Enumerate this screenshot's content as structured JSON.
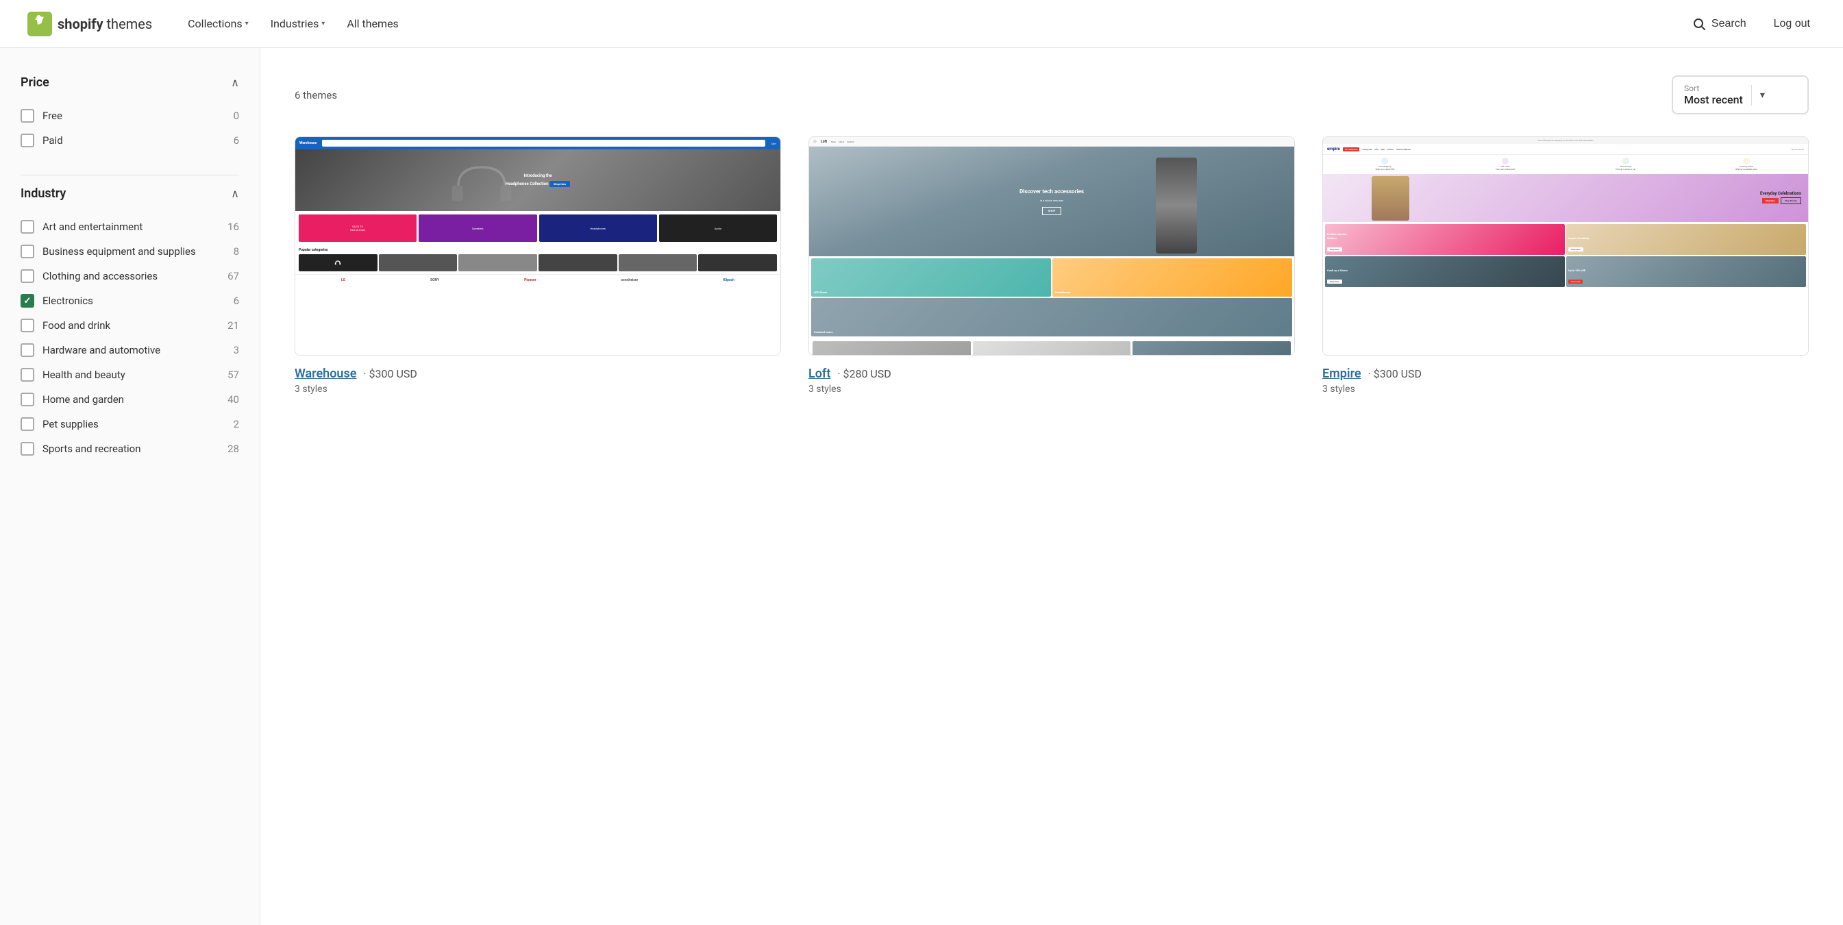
{
  "header": {
    "logo_text_brand": "shopify",
    "logo_text_suffix": " themes",
    "nav": [
      {
        "id": "collections",
        "label": "Collections",
        "has_dropdown": true
      },
      {
        "id": "industries",
        "label": "Industries",
        "has_dropdown": true
      },
      {
        "id": "all-themes",
        "label": "All themes",
        "has_dropdown": false
      }
    ],
    "search_label": "Search",
    "logout_label": "Log out"
  },
  "sidebar": {
    "price_section": {
      "title": "Price",
      "items": [
        {
          "id": "free",
          "label": "Free",
          "count": "0",
          "checked": false
        },
        {
          "id": "paid",
          "label": "Paid",
          "count": "6",
          "checked": false
        }
      ]
    },
    "industry_section": {
      "title": "Industry",
      "items": [
        {
          "id": "art",
          "label": "Art and entertainment",
          "count": "16",
          "checked": false
        },
        {
          "id": "business",
          "label": "Business equipment and supplies",
          "count": "8",
          "checked": false
        },
        {
          "id": "clothing",
          "label": "Clothing and accessories",
          "count": "67",
          "checked": false
        },
        {
          "id": "electronics",
          "label": "Electronics",
          "count": "6",
          "checked": true
        },
        {
          "id": "food",
          "label": "Food and drink",
          "count": "21",
          "checked": false
        },
        {
          "id": "hardware",
          "label": "Hardware and automotive",
          "count": "3",
          "checked": false
        },
        {
          "id": "health",
          "label": "Health and beauty",
          "count": "57",
          "checked": false
        },
        {
          "id": "home",
          "label": "Home and garden",
          "count": "40",
          "checked": false
        },
        {
          "id": "pet",
          "label": "Pet supplies",
          "count": "2",
          "checked": false
        },
        {
          "id": "sports",
          "label": "Sports and recreation",
          "count": "28",
          "checked": false
        }
      ]
    }
  },
  "content": {
    "themes_count_label": "6 themes",
    "sort": {
      "label": "Sort",
      "value": "Most recent"
    },
    "themes": [
      {
        "id": "warehouse",
        "name": "Warehouse",
        "price": "· $300 USD",
        "styles": "3 styles",
        "mockup": "warehouse"
      },
      {
        "id": "loft",
        "name": "Loft",
        "price": "· $280 USD",
        "styles": "3 styles",
        "mockup": "loft"
      },
      {
        "id": "empire",
        "name": "Empire",
        "price": "· $300 USD",
        "styles": "3 styles",
        "mockup": "empire"
      }
    ]
  }
}
